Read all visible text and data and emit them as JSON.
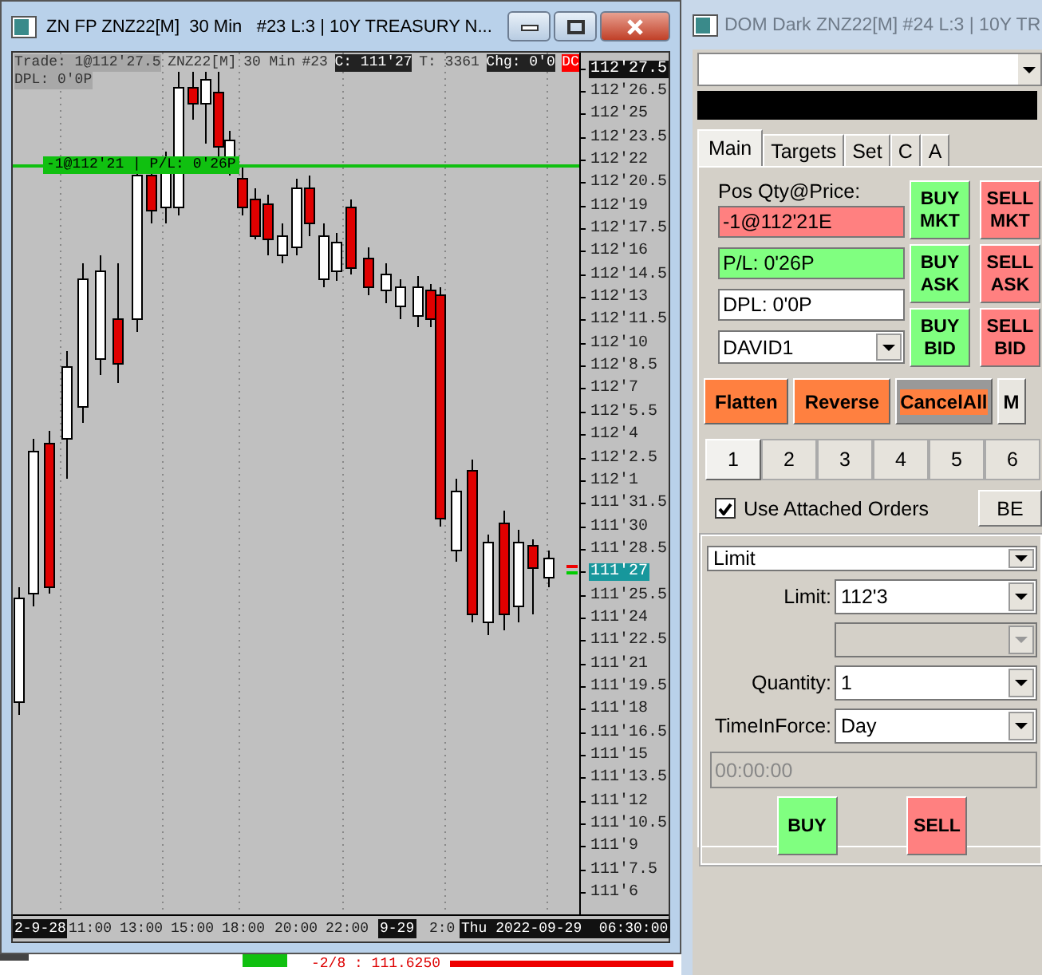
{
  "chart_window": {
    "title": "ZN FP ZNZ22[M]  30 Min   #23 L:3 | 10Y TREASURY N...",
    "active": true
  },
  "chart": {
    "info": [
      {
        "text": "Trade: 1@112'27.5",
        "kind": "grey"
      },
      {
        "text": "ZNZ22[M]",
        "kind": "plain"
      },
      {
        "text": "30 Min",
        "kind": "plain"
      },
      {
        "text": "#23",
        "kind": "plain"
      },
      {
        "text": "C: 111'27",
        "kind": "dark"
      },
      {
        "text": "T: 3361",
        "kind": "plain"
      },
      {
        "text": "Chg: 0'0",
        "kind": "dark"
      },
      {
        "text": "DC",
        "kind": "alert"
      }
    ],
    "dpl": "DPL: 0'0P",
    "position_label": "-1@112'21 | P/L: 0'26P",
    "price_axis": [
      {
        "text": "112'27.5",
        "kind": "last"
      },
      {
        "text": "112'26.5",
        "kind": "tick"
      },
      {
        "text": "112'25",
        "kind": "tick"
      },
      {
        "text": "112'23.5",
        "kind": "tick"
      },
      {
        "text": "112'22",
        "kind": "tick"
      },
      {
        "text": "112'20.5",
        "kind": "tick"
      },
      {
        "text": "112'19",
        "kind": "tick"
      },
      {
        "text": "112'17.5",
        "kind": "tick"
      },
      {
        "text": "112'16",
        "kind": "tick"
      },
      {
        "text": "112'14.5",
        "kind": "tick"
      },
      {
        "text": "112'13",
        "kind": "tick"
      },
      {
        "text": "112'11.5",
        "kind": "tick"
      },
      {
        "text": "112'10",
        "kind": "tick"
      },
      {
        "text": "112'8.5",
        "kind": "tick"
      },
      {
        "text": "112'7",
        "kind": "tick"
      },
      {
        "text": "112'5.5",
        "kind": "tick"
      },
      {
        "text": "112'4",
        "kind": "tick"
      },
      {
        "text": "112'2.5",
        "kind": "tick"
      },
      {
        "text": "112'1",
        "kind": "tick"
      },
      {
        "text": "111'31.5",
        "kind": "tick"
      },
      {
        "text": "111'30",
        "kind": "tick"
      },
      {
        "text": "111'28.5",
        "kind": "tick"
      },
      {
        "text": "111'27",
        "kind": "current"
      },
      {
        "text": "111'25.5",
        "kind": "tick"
      },
      {
        "text": "111'24",
        "kind": "tick"
      },
      {
        "text": "111'22.5",
        "kind": "tick"
      },
      {
        "text": "111'21",
        "kind": "tick"
      },
      {
        "text": "111'19.5",
        "kind": "tick"
      },
      {
        "text": "111'18",
        "kind": "tick"
      },
      {
        "text": "111'16.5",
        "kind": "tick"
      },
      {
        "text": "111'15",
        "kind": "tick"
      },
      {
        "text": "111'13.5",
        "kind": "tick"
      },
      {
        "text": "111'12",
        "kind": "tick"
      },
      {
        "text": "111'10.5",
        "kind": "tick"
      },
      {
        "text": "111'9",
        "kind": "tick"
      },
      {
        "text": "111'7.5",
        "kind": "tick"
      },
      {
        "text": "111'6",
        "kind": "tick"
      }
    ],
    "time_axis": [
      {
        "text": "2-9-28",
        "kind": "date"
      },
      {
        "text": "11:00",
        "kind": "tick"
      },
      {
        "text": "13:00",
        "kind": "tick"
      },
      {
        "text": "15:00",
        "kind": "tick"
      },
      {
        "text": "18:00",
        "kind": "tick"
      },
      {
        "text": "20:00",
        "kind": "tick"
      },
      {
        "text": "22:00",
        "kind": "tick"
      },
      {
        "text": "9-29",
        "kind": "date"
      },
      {
        "text": "2:0",
        "kind": "tick"
      },
      {
        "text": "Thu 2022-09-29  06:30:00",
        "kind": "date"
      }
    ]
  },
  "background_window": {
    "price_text": "-2/8 : 111.6250"
  },
  "dom_window": {
    "title": "DOM Dark ZNZ22[M]  #24 L:3 | 10Y TR",
    "active": false,
    "tabs": [
      {
        "label": "Main",
        "selected": true
      },
      {
        "label": "Targets",
        "selected": false
      },
      {
        "label": "Set",
        "selected": false
      },
      {
        "label": "C",
        "selected": false
      },
      {
        "label": "A",
        "selected": false
      }
    ],
    "position": {
      "label": "Pos Qty@Price:",
      "value": "-1@112'21E",
      "pl": "P/L: 0'26P",
      "dpl": "DPL: 0'0P",
      "account": "DAVID1"
    },
    "order_buttons": [
      {
        "label": "BUY MKT",
        "kind": "buy"
      },
      {
        "label": "SELL MKT",
        "kind": "sell"
      },
      {
        "label": "BUY ASK",
        "kind": "buy"
      },
      {
        "label": "SELL ASK",
        "kind": "sell"
      },
      {
        "label": "BUY BID",
        "kind": "buy"
      },
      {
        "label": "SELL BID",
        "kind": "sell"
      }
    ],
    "actions": [
      {
        "label": "Flatten",
        "kind": "orange"
      },
      {
        "label": "Reverse",
        "kind": "orange"
      },
      {
        "label": "CancelAll",
        "kind": "cancel"
      },
      {
        "label": "M",
        "kind": "plain"
      }
    ],
    "quantity_tabs": [
      {
        "label": "1",
        "selected": true
      },
      {
        "label": "2",
        "selected": false
      },
      {
        "label": "3",
        "selected": false
      },
      {
        "label": "4",
        "selected": false
      },
      {
        "label": "5",
        "selected": false
      },
      {
        "label": "6",
        "selected": false
      }
    ],
    "attached_orders": {
      "label": "Use Attached Orders",
      "checked": true
    },
    "be_button": "BE",
    "order_type": "Limit",
    "fields": [
      {
        "label": "Limit:",
        "value": "112'3",
        "disabled": false
      },
      {
        "disabled": true
      },
      {
        "label": "Quantity:",
        "value": "1",
        "disabled": false
      },
      {
        "label": "TimeInForce:",
        "value": "Day",
        "disabled": false
      }
    ],
    "time_field": {
      "value": "00:00:00",
      "disabled": true
    },
    "submit_buttons": [
      {
        "label": "BUY",
        "kind": "buy"
      },
      {
        "label": "SELL",
        "kind": "sell"
      }
    ]
  }
}
